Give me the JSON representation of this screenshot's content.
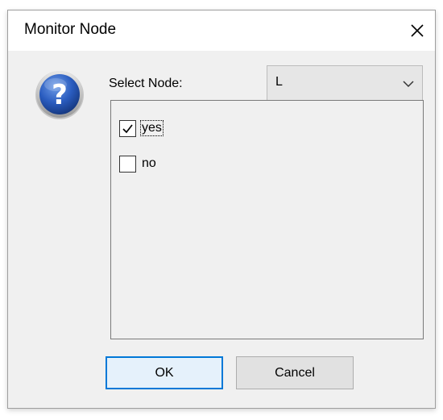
{
  "window": {
    "title": "Monitor Node",
    "close_icon": "close-icon"
  },
  "prompt": {
    "icon": "question-icon",
    "select_label": "Select Node:"
  },
  "node_select": {
    "selected_value": "L",
    "icon": "chevron-down-icon"
  },
  "options": [
    {
      "label": "yes",
      "checked": true
    },
    {
      "label": "no",
      "checked": false
    }
  ],
  "buttons": {
    "ok_label": "OK",
    "cancel_label": "Cancel"
  },
  "colors": {
    "accent": "#0078d7",
    "icon_blue": "#1f4fa3"
  }
}
